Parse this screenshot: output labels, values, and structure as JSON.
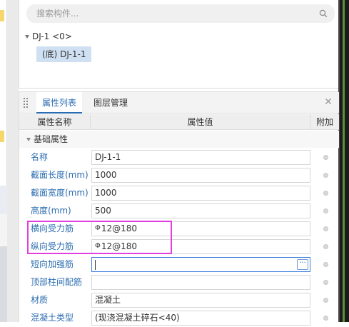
{
  "search": {
    "placeholder": "搜索构件..."
  },
  "tree": {
    "root_label": "DJ-1 <0>",
    "child_label": "(底) DJ-1-1"
  },
  "tabs": [
    {
      "label": "属性列表",
      "active": true
    },
    {
      "label": "图层管理",
      "active": false
    }
  ],
  "table": {
    "headers": [
      "属性名称",
      "属性值",
      "附加"
    ]
  },
  "group": {
    "label": "基础属性"
  },
  "properties": [
    {
      "name": "名称",
      "value": "DJ-1-1"
    },
    {
      "name": "截面长度(mm)",
      "value": "1000"
    },
    {
      "name": "截面宽度(mm)",
      "value": "1000"
    },
    {
      "name": "高度(mm)",
      "value": "500"
    },
    {
      "name": "横向受力筋",
      "value": "12@180",
      "steel_symbol": "Φ"
    },
    {
      "name": "纵向受力筋",
      "value": "12@180",
      "steel_symbol": "Φ"
    },
    {
      "name": "短向加强筋",
      "value": ""
    },
    {
      "name": "顶部柱间配筋",
      "value": ""
    },
    {
      "name": "材质",
      "value": "混凝土"
    },
    {
      "name": "混凝土类型",
      "value": "(现浇混凝土碎石<40)"
    }
  ],
  "icons": {
    "search": "search-icon",
    "close": "close-icon",
    "ellipsis": "ellipsis-icon"
  },
  "colors": {
    "accent": "#2b6cb0",
    "highlight": "#e040e0",
    "selected_bg": "#cfe0f2"
  }
}
